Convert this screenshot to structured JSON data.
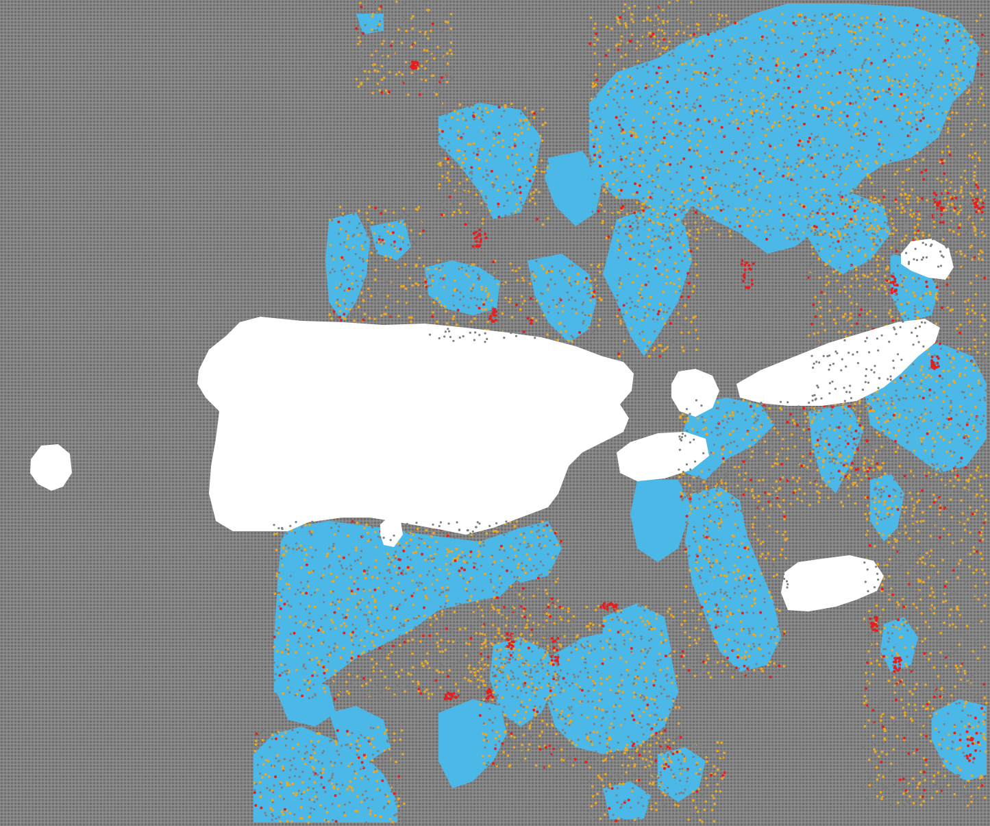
{
  "map": {
    "kind": "classified-point-grid",
    "legend_shown": false,
    "text_labels_shown": false,
    "categories": [
      {
        "id": "background",
        "color": "#7f7f7f",
        "share_estimate": 0.52
      },
      {
        "id": "light-blue",
        "color": "#4cb8e8",
        "share_estimate": 0.36
      },
      {
        "id": "orange",
        "color": "#e8a82a",
        "share_estimate": 0.09
      },
      {
        "id": "red",
        "color": "#e41f1f",
        "share_estimate": 0.03
      }
    ],
    "masked_area_color": "#ffffff"
  }
}
